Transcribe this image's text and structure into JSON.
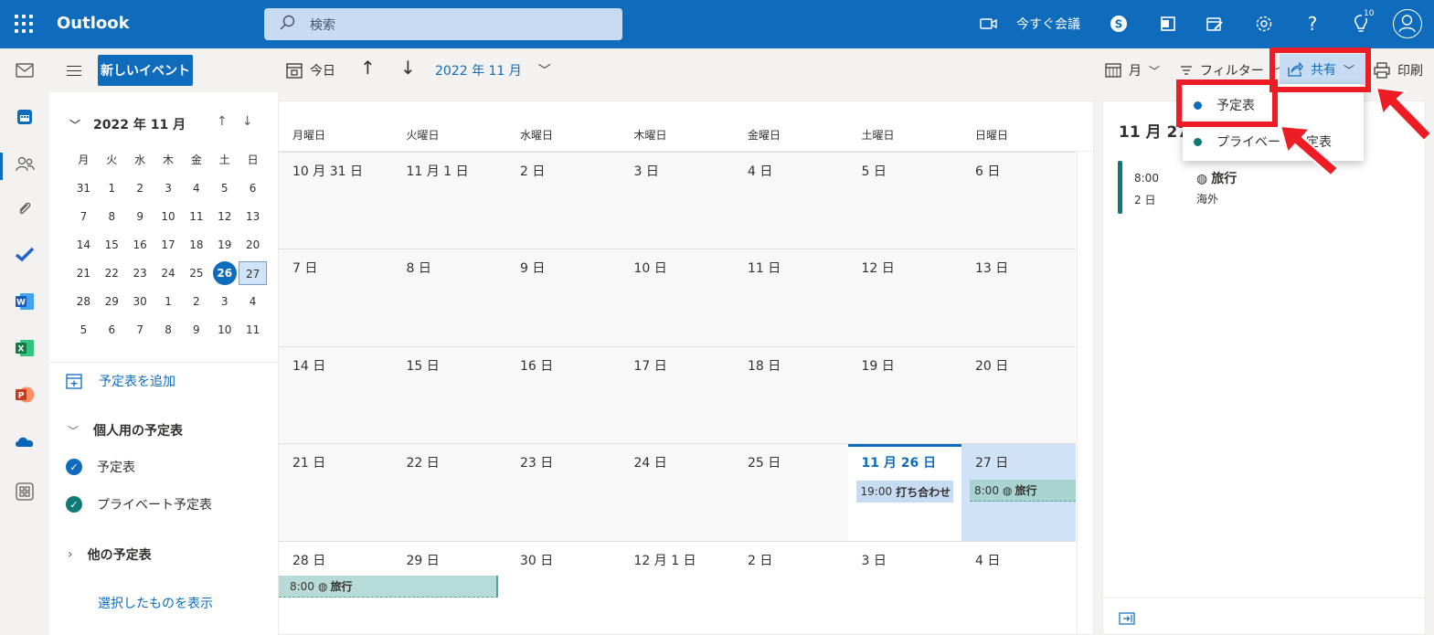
{
  "app": {
    "name": "Outlook"
  },
  "search": {
    "placeholder": "検索"
  },
  "topbar": {
    "meet_now": "今すぐ会議",
    "notification_count": "10"
  },
  "sidebar": {
    "new_event": "新しいイベント",
    "mini_calendar": {
      "title": "2022 年 11 月",
      "weekdays": [
        "月",
        "火",
        "水",
        "木",
        "金",
        "土",
        "日"
      ],
      "weeks": [
        [
          "31",
          "1",
          "2",
          "3",
          "4",
          "5",
          "6"
        ],
        [
          "7",
          "8",
          "9",
          "10",
          "11",
          "12",
          "13"
        ],
        [
          "14",
          "15",
          "16",
          "17",
          "18",
          "19",
          "20"
        ],
        [
          "21",
          "22",
          "23",
          "24",
          "25",
          "26",
          "27"
        ],
        [
          "28",
          "29",
          "30",
          "1",
          "2",
          "3",
          "4"
        ],
        [
          "5",
          "6",
          "7",
          "8",
          "9",
          "10",
          "11"
        ]
      ],
      "today": "26",
      "selected": "27"
    },
    "add_calendar": "予定表を追加",
    "personal_group": "個人用の予定表",
    "calendars": [
      {
        "name": "予定表",
        "color": "#0f6cbd"
      },
      {
        "name": "プライベート予定表",
        "color": "#0f7b74"
      }
    ],
    "other_group": "他の予定表",
    "show_selected": "選択したものを表示"
  },
  "toolbar": {
    "today": "今日",
    "range": "2022 年 11 月",
    "view": "月",
    "filter": "フィルター",
    "share": "共有",
    "print": "印刷"
  },
  "share_menu": {
    "items": [
      {
        "label": "予定表",
        "color": "#0f6cbd"
      },
      {
        "label": "プライベート予定表",
        "color": "#0f7b74"
      }
    ]
  },
  "calendar": {
    "weekdays": [
      "月曜日",
      "火曜日",
      "水曜日",
      "木曜日",
      "金曜日",
      "土曜日",
      "日曜日"
    ],
    "weeks": [
      [
        "10 月 31 日",
        "11 月 1 日",
        "2 日",
        "3 日",
        "4 日",
        "5 日",
        "6 日"
      ],
      [
        "7 日",
        "8 日",
        "9 日",
        "10 日",
        "11 日",
        "12 日",
        "13 日"
      ],
      [
        "14 日",
        "15 日",
        "16 日",
        "17 日",
        "18 日",
        "19 日",
        "20 日"
      ],
      [
        "21 日",
        "22 日",
        "23 日",
        "24 日",
        "25 日",
        "11 月 26 日",
        "27 日"
      ],
      [
        "28 日",
        "29 日",
        "30 日",
        "12 月 1 日",
        "2 日",
        "3 日",
        "4 日"
      ]
    ],
    "events": {
      "meeting": {
        "time": "19:00",
        "title": "打ち合わせ",
        "color": "#c7dcf2"
      },
      "trip": {
        "time": "8:00",
        "title": "旅行",
        "color": "#b7dcd8"
      }
    }
  },
  "detail": {
    "date_header": "11 月 27",
    "event": {
      "time": "8:00",
      "duration": "2 日",
      "title": "旅行",
      "location": "海外"
    }
  },
  "colors": {
    "brand": "#0f6cbd",
    "annotation": "#ee1c24"
  }
}
